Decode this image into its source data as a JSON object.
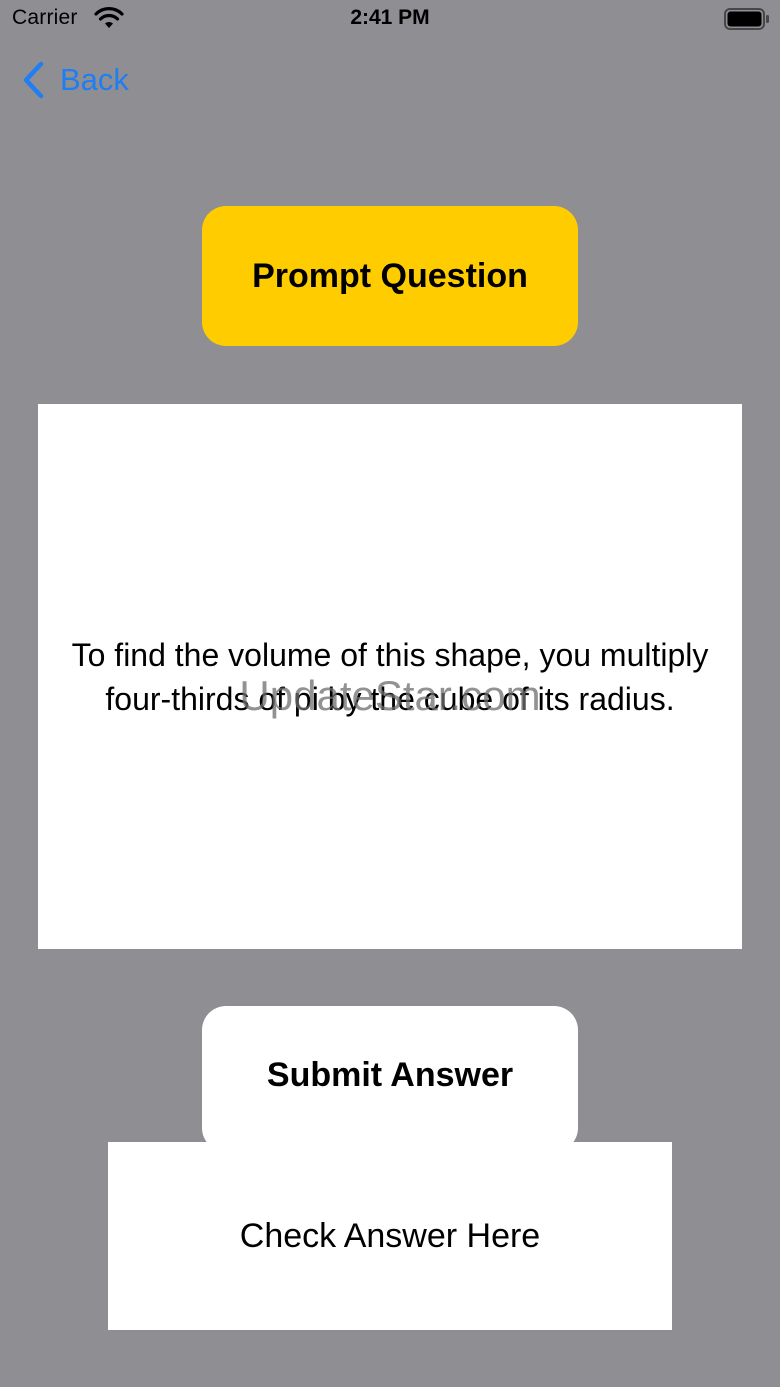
{
  "status_bar": {
    "carrier": "Carrier",
    "time": "2:41 PM",
    "wifi_icon": "wifi-icon",
    "battery_icon": "battery-full-icon"
  },
  "nav": {
    "back_label": "Back",
    "back_icon": "chevron-left-icon",
    "accent_color": "#1e7ef3"
  },
  "prompt": {
    "button_label": "Prompt Question",
    "button_color": "#ffcc00"
  },
  "question": {
    "text": "To find the volume of this shape, you multiply four-thirds of pi by the cube of its radius."
  },
  "watermark": {
    "text": "UpdateStar.com"
  },
  "actions": {
    "submit_label": "Submit Answer"
  },
  "answer": {
    "placeholder": "Check Answer Here",
    "value": ""
  },
  "colors": {
    "background": "#8e8e93",
    "panel": "#ffffff"
  }
}
